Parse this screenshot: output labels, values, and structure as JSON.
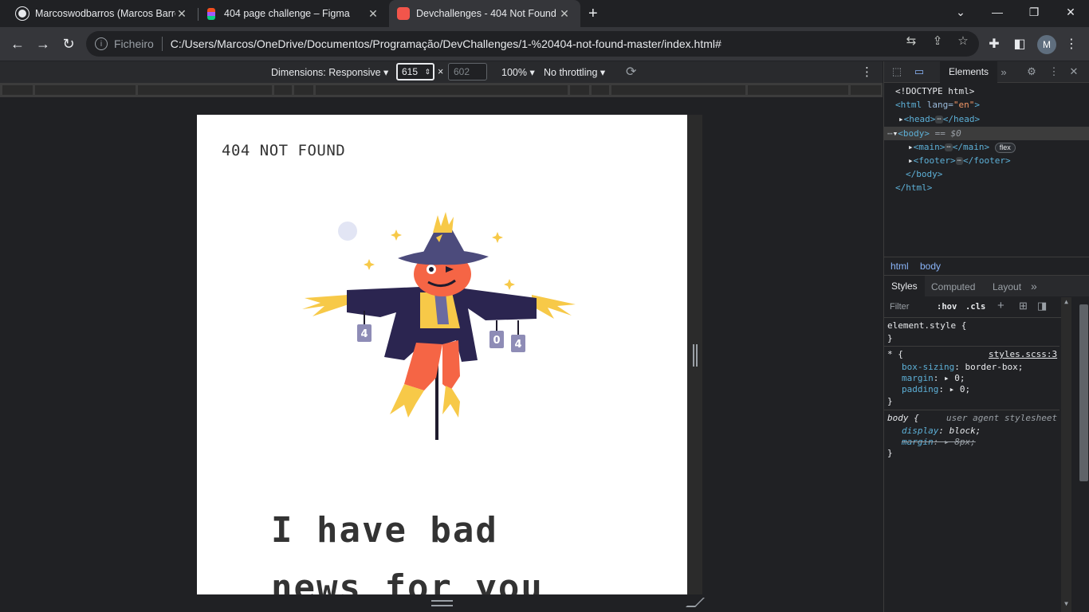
{
  "tabs": [
    {
      "title": "Marcoswodbarros (Marcos Barros",
      "favicon": "github-icon",
      "close": "✕"
    },
    {
      "title": "404 page challenge – Figma",
      "favicon": "figma-icon",
      "close": "✕"
    },
    {
      "title": "Devchallenges - 404 Not Found",
      "favicon": "devchallenges-icon",
      "close": "✕"
    }
  ],
  "new_tab": "+",
  "window_controls": {
    "dropdown": "⌄",
    "minimize": "—",
    "restore": "❐",
    "close": "✕"
  },
  "toolbar": {
    "scheme_label": "Ficheiro",
    "url": "C:/Users/Marcos/OneDrive/Documentos/Programação/DevChallenges/1-%20404-not-found-master/index.html#",
    "avatar_letter": "M"
  },
  "device_toolbar": {
    "dimensions": "Dimensions: Responsive ▾",
    "width": "615",
    "times": "×",
    "height": "602",
    "zoom": "100% ▾",
    "throttling": "No throttling ▾"
  },
  "page": {
    "logo": "404 NOT FOUND",
    "headline_line1": "I have bad",
    "headline_line2": "news for you",
    "can_digits": [
      "4",
      "0",
      "4"
    ]
  },
  "devtools": {
    "active_tab": "Elements",
    "dom": {
      "doctype": "<!DOCTYPE html>",
      "html_open_tag": "<html",
      "html_lang_attr": " lang=",
      "html_lang_val": "\"en\"",
      "html_open_close": ">",
      "head_open": "<head>",
      "head_close": "</head>",
      "body_open": "<body>",
      "body_marker": " == $0",
      "main_open": "<main>",
      "main_close": "</main>",
      "flex_badge": "flex",
      "footer_open": "<footer>",
      "footer_close": "</footer>",
      "body_close": "</body>",
      "html_close": "</html>",
      "ellipsis": "⋯"
    },
    "breadcrumbs": [
      "html",
      "body"
    ],
    "style_tabs": [
      "Styles",
      "Computed",
      "Layout"
    ],
    "filter_placeholder": "Filter",
    "hov": ":hov",
    "cls": ".cls",
    "rules": {
      "element_style": "element.style {",
      "close_brace": "}",
      "star_selector": "* {",
      "star_source": "styles.scss:3",
      "star_props": [
        {
          "name": "box-sizing",
          "value": "border-box;"
        },
        {
          "name": "margin",
          "value": "▸ 0;"
        },
        {
          "name": "padding",
          "value": "▸ 0;"
        }
      ],
      "body_selector": "body {",
      "body_source": "user agent stylesheet",
      "body_props": [
        {
          "name": "display",
          "value": "block;"
        },
        {
          "name": "margin",
          "value": "▸ 8px;"
        }
      ]
    }
  },
  "colors": {
    "chrome_bg": "#202124",
    "toolbar_bg": "#35363a",
    "page_bg": "#ffffff",
    "text_dark": "#333333",
    "scarecrow_hat": "#4c4b7c",
    "scarecrow_face": "#f56545",
    "straw": "#f7c948"
  }
}
